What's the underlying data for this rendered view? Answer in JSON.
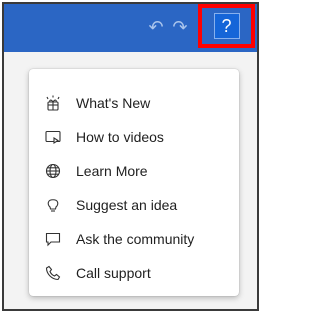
{
  "toolbar": {
    "undo_icon": "undo-icon",
    "redo_icon": "redo-icon",
    "help_label": "?",
    "accent_color": "#2b66c4",
    "highlight_color": "#ff0000"
  },
  "help_menu": {
    "items": [
      {
        "label": "What's New",
        "icon": "sparkle-icon"
      },
      {
        "label": "How to videos",
        "icon": "video-icon"
      },
      {
        "label": "Learn More",
        "icon": "globe-icon"
      },
      {
        "label": "Suggest an idea",
        "icon": "lightbulb-icon"
      },
      {
        "label": "Ask the community",
        "icon": "chat-icon"
      },
      {
        "label": "Call support",
        "icon": "phone-icon"
      }
    ]
  }
}
